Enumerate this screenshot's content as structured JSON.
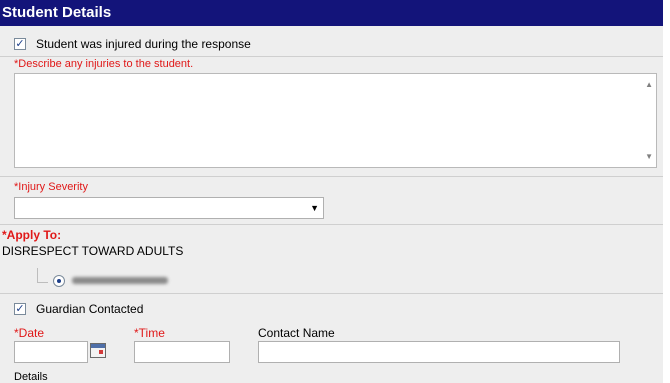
{
  "section": {
    "title": "Student Details"
  },
  "injury": {
    "checkbox_label": "Student was injured during the response",
    "checked": true,
    "describe_label": "*Describe any injuries to the student.",
    "describe_value": ""
  },
  "severity": {
    "label": "*Injury Severity",
    "selected": ""
  },
  "apply_to": {
    "label": "*Apply To:",
    "group": "DISRESPECT TOWARD ADULTS",
    "selected_student_redacted": true
  },
  "guardian": {
    "checkbox_label": "Guardian Contacted",
    "checked": true,
    "date_label": "*Date",
    "date_value": "",
    "time_label": "*Time",
    "time_value": "",
    "contact_name_label": "Contact Name",
    "contact_name_value": "",
    "details_label": "Details"
  },
  "colors": {
    "header_bg": "#13147a",
    "required": "#e01818",
    "panel_bg": "#eeeeee"
  }
}
